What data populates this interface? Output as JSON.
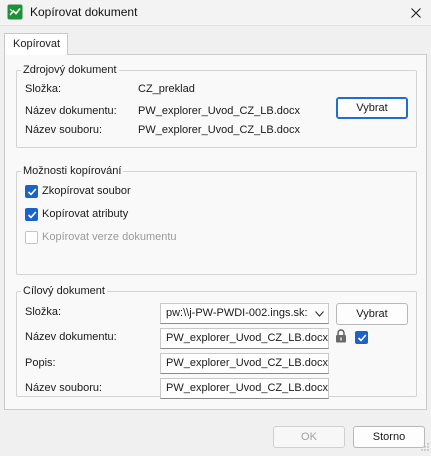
{
  "window": {
    "title": "Kopírovat dokument",
    "colors": {
      "accent": "#1e6fd0",
      "checkbox": "#1a64c8",
      "app_icon": "#1f8f3a"
    },
    "icons": {
      "app": "app-icon",
      "close": "close-icon"
    }
  },
  "tabs": [
    {
      "label": "Kopírovat",
      "selected": true
    }
  ],
  "source": {
    "legend": "Zdrojový dokument",
    "folder_label": "Složka:",
    "folder_value": "CZ_preklad",
    "docname_label": "Název dokumentu:",
    "docname_value": "PW_explorer_Uvod_CZ_LB.docx",
    "filename_label": "Název souboru:",
    "filename_value": "PW_explorer_Uvod_CZ_LB.docx",
    "select_button": "Vybrat"
  },
  "options": {
    "legend": "Možnosti kopírování",
    "items": [
      {
        "label": "Zkopírovat soubor",
        "checked": true,
        "enabled": true
      },
      {
        "label": "Kopírovat atributy",
        "checked": true,
        "enabled": true
      },
      {
        "label": "Kopírovat verze dokumentu",
        "checked": false,
        "enabled": false
      }
    ]
  },
  "target": {
    "legend": "Cílový dokument",
    "folder_label": "Složka:",
    "folder_value": "pw:\\\\j-PW-PWDI-002.ings.sk:",
    "select_button": "Vybrat",
    "docname_label": "Název dokumentu:",
    "docname_value": "PW_explorer_Uvod_CZ_LB.docx",
    "lock_checked": true,
    "description_label": "Popis:",
    "description_value": "PW_explorer_Uvod_CZ_LB.docx",
    "filename_label": "Název souboru:",
    "filename_value": "PW_explorer_Uvod_CZ_LB.docx"
  },
  "footer": {
    "ok_label": "OK",
    "ok_enabled": false,
    "cancel_label": "Storno"
  }
}
